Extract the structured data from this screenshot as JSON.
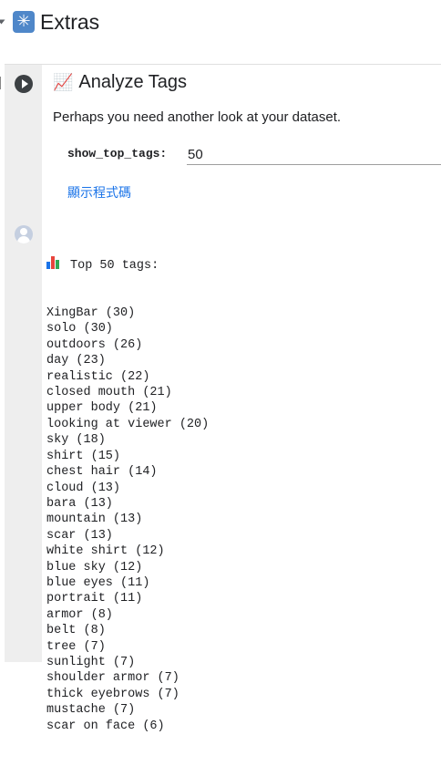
{
  "section": {
    "title": "Extras",
    "icon": "asterisk-icon"
  },
  "cell": {
    "title": "Analyze Tags",
    "description": "Perhaps you need another look at your dataset.",
    "param_label": "show_top_tags:",
    "param_value": "50",
    "show_code_label": "顯示程式碼"
  },
  "output": {
    "header": "Top 50 tags:",
    "tags": [
      "XingBar (30)",
      "solo (30)",
      "outdoors (26)",
      "day (23)",
      "realistic (22)",
      "closed mouth (21)",
      "upper body (21)",
      "looking at viewer (20)",
      "sky (18)",
      "shirt (15)",
      "chest hair (14)",
      "cloud (13)",
      "bara (13)",
      "mountain (13)",
      "scar (13)",
      "white shirt (12)",
      "blue sky (12)",
      "blue eyes (11)",
      "portrait (11)",
      "armor (8)",
      "belt (8)",
      "tree (7)",
      "sunlight (7)",
      "shoulder armor (7)",
      "thick eyebrows (7)",
      "mustache (7)",
      "scar on face (6)"
    ]
  },
  "colors": {
    "link": "#1a73e8",
    "section_icon_bg": "#4f87c9",
    "gutter_bg": "#eeeeee"
  }
}
